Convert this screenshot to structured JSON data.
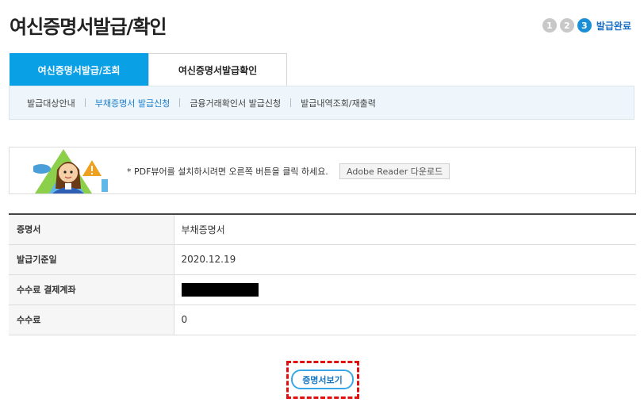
{
  "page": {
    "title": "여신증명서발급/확인"
  },
  "steps": {
    "items": [
      "1",
      "2",
      "3"
    ],
    "active_index": 2,
    "current_label": "발급완료"
  },
  "tabs": [
    {
      "label": "여신증명서발급/조회",
      "active": true
    },
    {
      "label": "여신증명서발급확인",
      "active": false
    }
  ],
  "subnav": [
    {
      "label": "발급대상안내",
      "active": false
    },
    {
      "label": "부채증명서 발급신청",
      "active": true
    },
    {
      "label": "금융거래확인서 발급신청",
      "active": false
    },
    {
      "label": "발급내역조회/재출력",
      "active": false
    }
  ],
  "notice": {
    "text": "* PDF뷰어를 설치하시려면 오른쪽 버튼을 클릭 하세요.",
    "button_label": "Adobe Reader 다운로드"
  },
  "table": {
    "rows": [
      {
        "label": "증명서",
        "value": "부채증명서"
      },
      {
        "label": "발급기준일",
        "value": "2020.12.19"
      },
      {
        "label": "수수료 결제계좌",
        "value": ""
      },
      {
        "label": "수수료",
        "value": "0"
      }
    ]
  },
  "actions": {
    "view_label": "증명서보기"
  },
  "colors": {
    "accent": "#0aa0e6",
    "highlight": "#e01010"
  }
}
